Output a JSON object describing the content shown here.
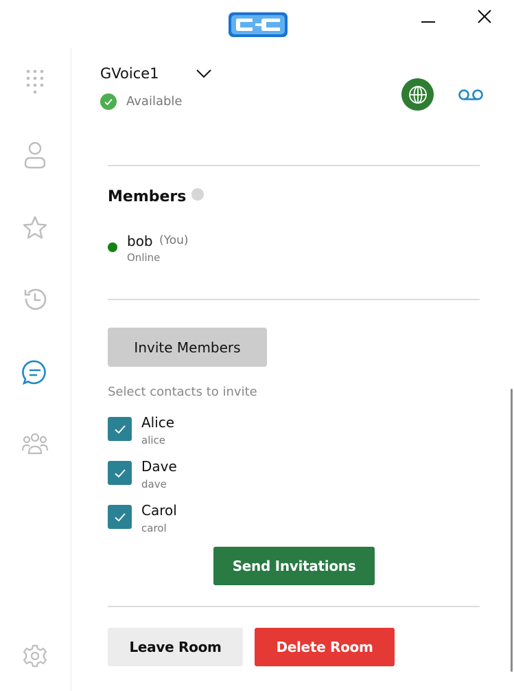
{
  "app": {
    "logo_icon": "brand-logo",
    "brand_color": "#1976d2"
  },
  "window_controls": {
    "minimize_icon": "minimize-icon",
    "close_icon": "close-icon"
  },
  "sidebar": {
    "items": [
      {
        "id": "dialpad",
        "icon": "dialpad-icon"
      },
      {
        "id": "contacts",
        "icon": "person-icon"
      },
      {
        "id": "favorites",
        "icon": "star-icon"
      },
      {
        "id": "history",
        "icon": "history-icon"
      },
      {
        "id": "chat",
        "icon": "chat-icon",
        "active": true
      },
      {
        "id": "groups",
        "icon": "group-icon"
      }
    ],
    "settings_icon": "gear-icon",
    "active_color": "#1e88c8"
  },
  "account": {
    "name": "GVoice1",
    "status": "Available",
    "status_color": "#4caf50"
  },
  "header_actions": {
    "globe_icon": "globe-icon",
    "globe_color": "#2e7d32",
    "voicemail_icon": "voicemail-icon"
  },
  "members": {
    "title": "Members",
    "list": [
      {
        "name": "bob",
        "tag": "(You)",
        "status": "Online"
      }
    ]
  },
  "invite": {
    "button_label": "Invite Members",
    "select_label": "Select contacts to invite",
    "contacts": [
      {
        "name": "Alice",
        "username": "alice",
        "checked": true
      },
      {
        "name": "Dave",
        "username": "dave",
        "checked": true
      },
      {
        "name": "Carol",
        "username": "carol",
        "checked": true
      }
    ],
    "send_label": "Send Invitations"
  },
  "room_actions": {
    "leave_label": "Leave Room",
    "delete_label": "Delete Room"
  }
}
